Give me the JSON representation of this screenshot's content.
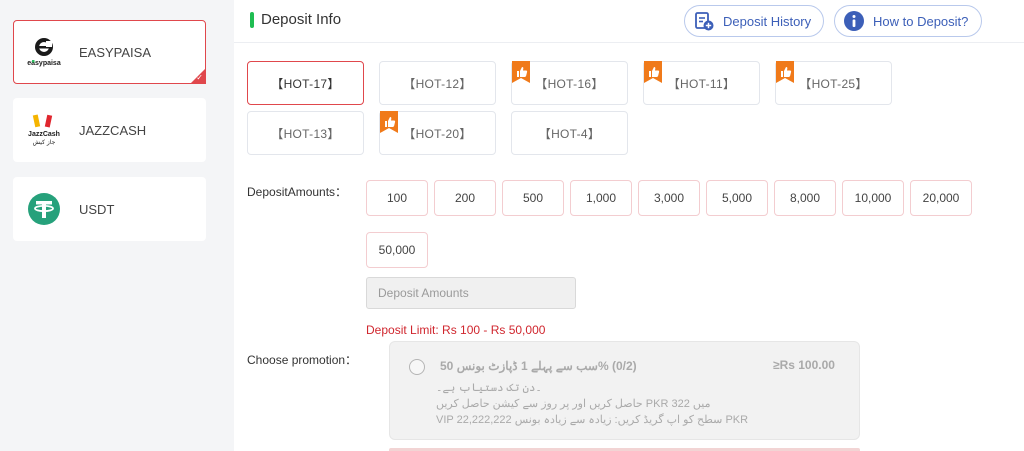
{
  "sidebar": {
    "items": [
      {
        "label": "EASYPAISA",
        "active": true
      },
      {
        "label": "JAZZCASH",
        "active": false
      },
      {
        "label": "USDT",
        "active": false
      }
    ],
    "easypaisa_logo_text": "easypaisa",
    "jazzcash_logo_text": "JazzCash",
    "jazzcash_logo_urdu": "جاز کیش"
  },
  "header": {
    "title": "Deposit Info",
    "history_label": "Deposit History",
    "howto_label": "How to Deposit?"
  },
  "channels": [
    "【HOT-17】",
    "【HOT-12】",
    "【HOT-16】",
    "【HOT-11】",
    "【HOT-25】",
    "【HOT-13】",
    "【HOT-20】",
    "【HOT-4】"
  ],
  "amounts": {
    "label": "DepositAmounts：",
    "options": [
      "100",
      "200",
      "500",
      "1,000",
      "3,000",
      "5,000",
      "8,000",
      "10,000",
      "20,000",
      "50,000"
    ],
    "input_placeholder": "Deposit Amounts",
    "limit_text": "Deposit Limit:  Rs  100  -  Rs  50,000"
  },
  "promotion": {
    "label": "Choose promotion：",
    "title": "(0/2) %سب سے پہلے 1 ڈپازٹ بونس 50",
    "min": "≥Rs  100.00",
    "lines": [
      "۔دن تک دستیاب ہے۔",
      "حاصل کریں اور پر روز سے کیشن حاصل کریں PKR میں 322",
      "VIP 22,222,222 سطح کو اپ گریڈ کریں: زیادہ سے زیادہ بونس PKR"
    ]
  },
  "colors": {
    "accent_red": "#e0474c",
    "green_bar": "#1fbd52",
    "blue_pill": "#3c5fb8",
    "limit_red": "#d0262e"
  }
}
